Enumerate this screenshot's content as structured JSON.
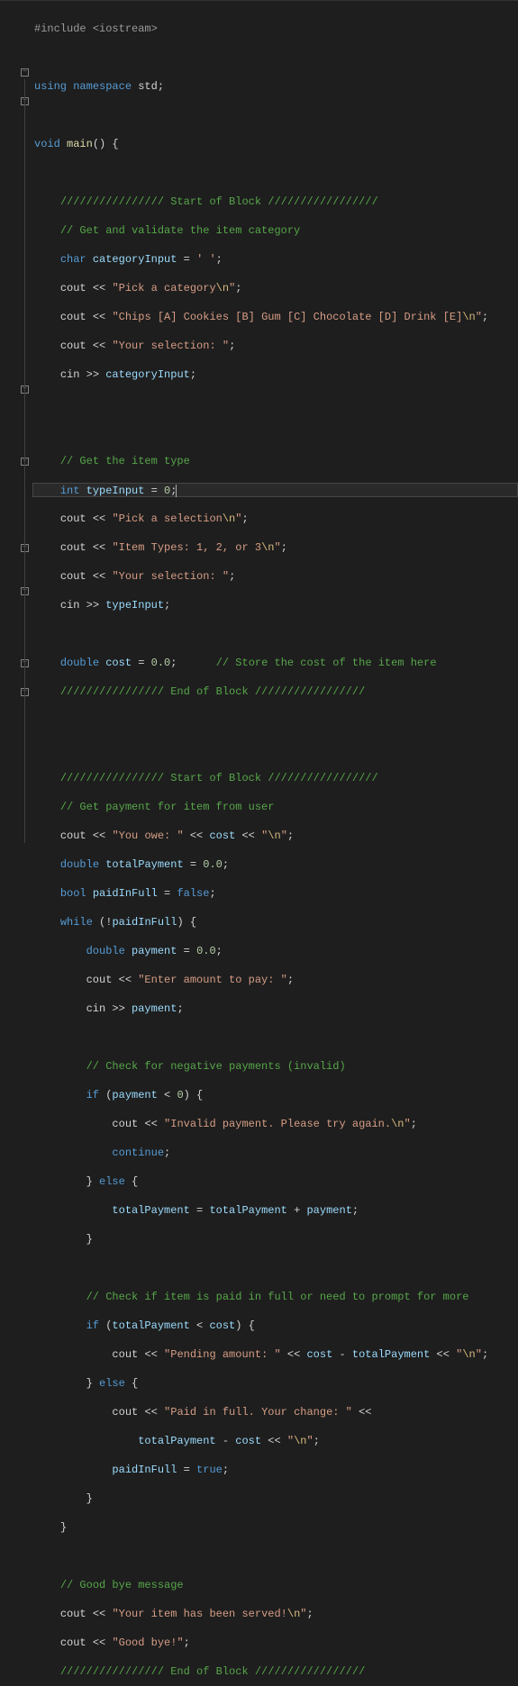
{
  "line1": {
    "pre": "#include ",
    "inc": "<iostream>"
  },
  "line3": {
    "kw1": "using",
    "kw2": "namespace",
    "ns": "std",
    "semi": ";"
  },
  "line5": {
    "ret": "void",
    "fn": "main",
    "paren": "() {"
  },
  "line7": {
    "cmt": "//////////////// Start of Block /////////////////"
  },
  "line8": {
    "cmt": "// Get and validate the item category"
  },
  "line9": {
    "type": "char",
    "var": "categoryInput",
    "eq": " = ",
    "val": "' '",
    "semi": ";"
  },
  "line10": {
    "obj": "cout",
    "op1": "<<",
    "str": "\"Pick a category",
    "esc": "\\n",
    "strend": "\"",
    "semi": ";"
  },
  "line11": {
    "obj": "cout",
    "op1": "<<",
    "str": "\"Chips [A] Cookies [B] Gum [C] Chocolate [D] Drink [E]",
    "esc": "\\n",
    "strend": "\"",
    "semi": ";"
  },
  "line12": {
    "obj": "cout",
    "op1": "<<",
    "str": "\"Your selection: \"",
    "semi": ";"
  },
  "line13": {
    "obj": "cin",
    "op1": ">>",
    "var": "categoryInput",
    "semi": ";"
  },
  "line16": {
    "cmt": "// Get the item type"
  },
  "line17": {
    "type": "int",
    "var": "typeInput",
    "eq": " = ",
    "val": "0",
    "semi": ";"
  },
  "line18": {
    "obj": "cout",
    "op1": "<<",
    "str": "\"Pick a selection",
    "esc": "\\n",
    "strend": "\"",
    "semi": ";"
  },
  "line19": {
    "obj": "cout",
    "op1": "<<",
    "str": "\"Item Types: 1, 2, or 3",
    "esc": "\\n",
    "strend": "\"",
    "semi": ";"
  },
  "line20": {
    "obj": "cout",
    "op1": "<<",
    "str": "\"Your selection: \"",
    "semi": ";"
  },
  "line21": {
    "obj": "cin",
    "op1": ">>",
    "var": "typeInput",
    "semi": ";"
  },
  "line23": {
    "type": "double",
    "var": "cost",
    "eq": " = ",
    "val": "0.0",
    "semi": ";",
    "cmt": "// Store the cost of the item here"
  },
  "line24": {
    "cmt": "//////////////// End of Block /////////////////"
  },
  "line27": {
    "cmt": "//////////////// Start of Block /////////////////"
  },
  "line28": {
    "cmt": "// Get payment for item from user"
  },
  "line29": {
    "obj": "cout",
    "op1": "<<",
    "str": "\"You owe: \"",
    "op2": "<<",
    "var": "cost",
    "op3": "<<",
    "str2": "\"",
    "esc": "\\n",
    "str2end": "\"",
    "semi": ";"
  },
  "line30": {
    "type": "double",
    "var": "totalPayment",
    "eq": " = ",
    "val": "0.0",
    "semi": ";"
  },
  "line31": {
    "type": "bool",
    "var": "paidInFull",
    "eq": " = ",
    "val": "false",
    "semi": ";"
  },
  "line32": {
    "kw": "while",
    "op": "(!",
    "var": "paidInFull",
    "close": ") {"
  },
  "line33": {
    "type": "double",
    "var": "payment",
    "eq": " = ",
    "val": "0.0",
    "semi": ";"
  },
  "line34": {
    "obj": "cout",
    "op1": "<<",
    "str": "\"Enter amount to pay: \"",
    "semi": ";"
  },
  "line35": {
    "obj": "cin",
    "op1": ">>",
    "var": "payment",
    "semi": ";"
  },
  "line37": {
    "cmt": "// Check for negative payments (invalid)"
  },
  "line38": {
    "kw": "if",
    "op": "(",
    "var": "payment",
    "cmp": " < ",
    "val": "0",
    "close": ") {"
  },
  "line39": {
    "obj": "cout",
    "op1": "<<",
    "str": "\"Invalid payment. Please try again.",
    "esc": "\\n",
    "strend": "\"",
    "semi": ";"
  },
  "line40": {
    "kw": "continue",
    "semi": ";"
  },
  "line41": {
    "close": "}",
    "kw": "else",
    "open": "{"
  },
  "line42": {
    "var1": "totalPayment",
    "eq": " = ",
    "var2": "totalPayment",
    "op": " + ",
    "var3": "payment",
    "semi": ";"
  },
  "line43": {
    "close": "}"
  },
  "line45": {
    "cmt": "// Check if item is paid in full or need to prompt for more"
  },
  "line46": {
    "kw": "if",
    "op": "(",
    "var": "totalPayment",
    "cmp": " < ",
    "var2": "cost",
    "close": ") {"
  },
  "line47": {
    "obj": "cout",
    "op1": "<<",
    "str": "\"Pending amount: \"",
    "op2": "<<",
    "var1": "cost",
    "minus": " - ",
    "var2": "totalPayment",
    "op3": "<<",
    "str2": "\"",
    "esc": "\\n",
    "str2end": "\"",
    "semi": ";"
  },
  "line48": {
    "close": "}",
    "kw": "else",
    "open": "{"
  },
  "line49": {
    "obj": "cout",
    "op1": "<<",
    "str": "\"Paid in full. Your change: \"",
    "op2": "<<"
  },
  "line50": {
    "var1": "totalPayment",
    "minus": " - ",
    "var2": "cost",
    "op": "<<",
    "str": "\"",
    "esc": "\\n",
    "strend": "\"",
    "semi": ";"
  },
  "line51": {
    "var": "paidInFull",
    "eq": " = ",
    "val": "true",
    "semi": ";"
  },
  "line52": {
    "close": "}"
  },
  "line53": {
    "close": "}"
  },
  "line55": {
    "cmt": "// Good bye message"
  },
  "line56": {
    "obj": "cout",
    "op1": "<<",
    "str": "\"Your item has been served!",
    "esc": "\\n",
    "strend": "\"",
    "semi": ";"
  },
  "line57": {
    "obj": "cout",
    "op1": "<<",
    "str": "\"Good bye!\"",
    "semi": ";"
  },
  "line58": {
    "cmt": "//////////////// End of Block /////////////////"
  }
}
